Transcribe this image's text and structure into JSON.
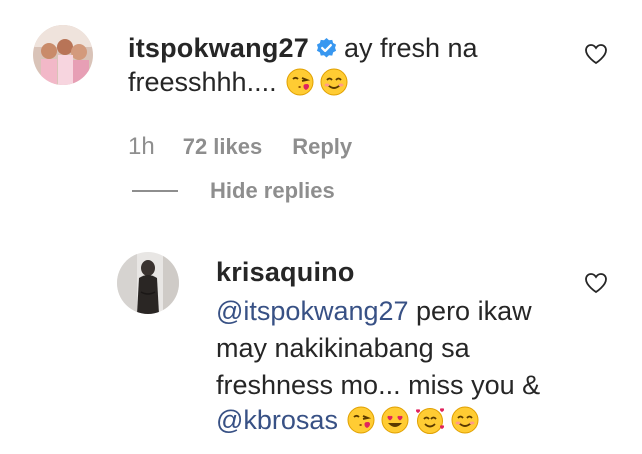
{
  "comments": [
    {
      "username": "itspokwang27",
      "verified": true,
      "text_line1": "ay fresh na",
      "text_line2": "freesshhh....",
      "emojis": [
        "face-blowing-kiss-emoji",
        "smiling-face-emoji"
      ],
      "time": "1h",
      "likes": "72 likes",
      "reply_label": "Reply",
      "hide_replies_label": "Hide replies"
    }
  ],
  "replies": [
    {
      "username": "krisaquino",
      "mention1": "@itspokwang27",
      "text_line1_rest": " pero ikaw",
      "text_line2": "may nakikinabang sa",
      "text_line3": "freshness mo... miss you &",
      "mention2": "@kbrosas",
      "emojis": [
        "face-blowing-kiss-emoji",
        "heart-eyes-emoji",
        "smiling-face-with-hearts-emoji",
        "smiling-face-emoji"
      ]
    }
  ],
  "colors": {
    "text": "#262626",
    "muted": "#8e8e8e",
    "mention": "#385185",
    "verified": "#3897f0",
    "emoji_yellow": "#ffcc33",
    "emoji_heart": "#e0245e"
  },
  "icons": {
    "like": "heart-outline-icon",
    "verified": "verified-badge-icon"
  }
}
